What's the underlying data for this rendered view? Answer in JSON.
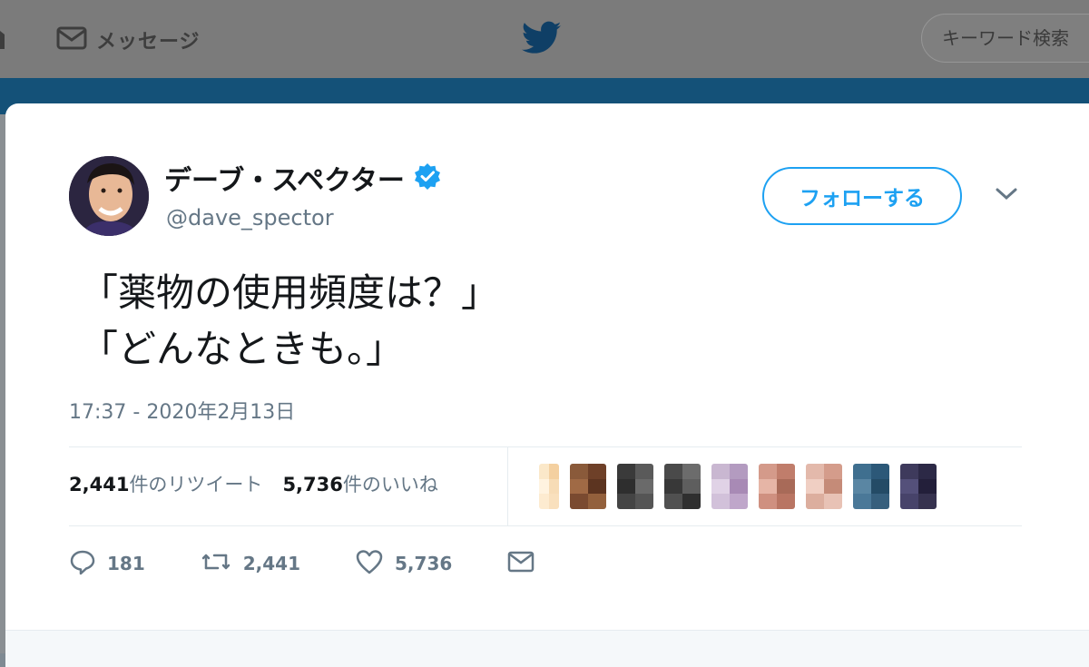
{
  "topbar": {
    "messages_label": "メッセージ",
    "search_placeholder": "キーワード検索",
    "brand_icon": "bird-logo-icon"
  },
  "tweet": {
    "display_name": "デーブ・スペクター",
    "verified": true,
    "handle": "@dave_spector",
    "follow_label": "フォローする",
    "text_line_1": "「薬物の使用頻度は？」",
    "text_line_2": "「どんなときも。」",
    "timestamp": "17:37 - 2020年2月13日",
    "retweets": {
      "count": "2,441",
      "suffix": "件のリツイート"
    },
    "likes": {
      "count": "5,736",
      "suffix": "件のいいね"
    },
    "actions": {
      "reply_count": "181",
      "retweet_count": "2,441",
      "like_count": "5,736"
    }
  },
  "colors": {
    "accent": "#1da1f2",
    "header_band": "#145178",
    "text_primary": "#14171a",
    "text_secondary": "#657786"
  },
  "liker_tiles": [
    [
      "#fbe8c9",
      "#f4d0a0",
      "#fff3e0",
      "#f7dcb6",
      "#fdebd0",
      "#f9e0bd"
    ],
    [
      "#8a5a3a",
      "#6e4028",
      "#a06a45",
      "#5c3420",
      "#7a4a30",
      "#93603c"
    ],
    [
      "#3a3a3a",
      "#5a5a5a",
      "#2e2e2e",
      "#6a6a6a",
      "#444444",
      "#555555"
    ],
    [
      "#4a4a4a",
      "#6c6c6c",
      "#383838",
      "#5e5e5e",
      "#505050",
      "#2f2f2f"
    ],
    [
      "#c9b7d1",
      "#b39bc0",
      "#e0d2e6",
      "#a88ab5",
      "#d2c1da",
      "#bfa6ca"
    ],
    [
      "#d49a8a",
      "#c07d6b",
      "#e6b5a6",
      "#a86a58",
      "#cf9080",
      "#b97563"
    ],
    [
      "#e3b9ab",
      "#d49c8b",
      "#f0cfc3",
      "#c58b78",
      "#dcae9e",
      "#e8c2b5"
    ],
    [
      "#3f6f8f",
      "#2c5878",
      "#5a86a3",
      "#244b66",
      "#4a7898",
      "#365f7d"
    ],
    [
      "#3e3a5c",
      "#2c2946",
      "#54507a",
      "#231f3a",
      "#47436a",
      "#36324f"
    ]
  ]
}
